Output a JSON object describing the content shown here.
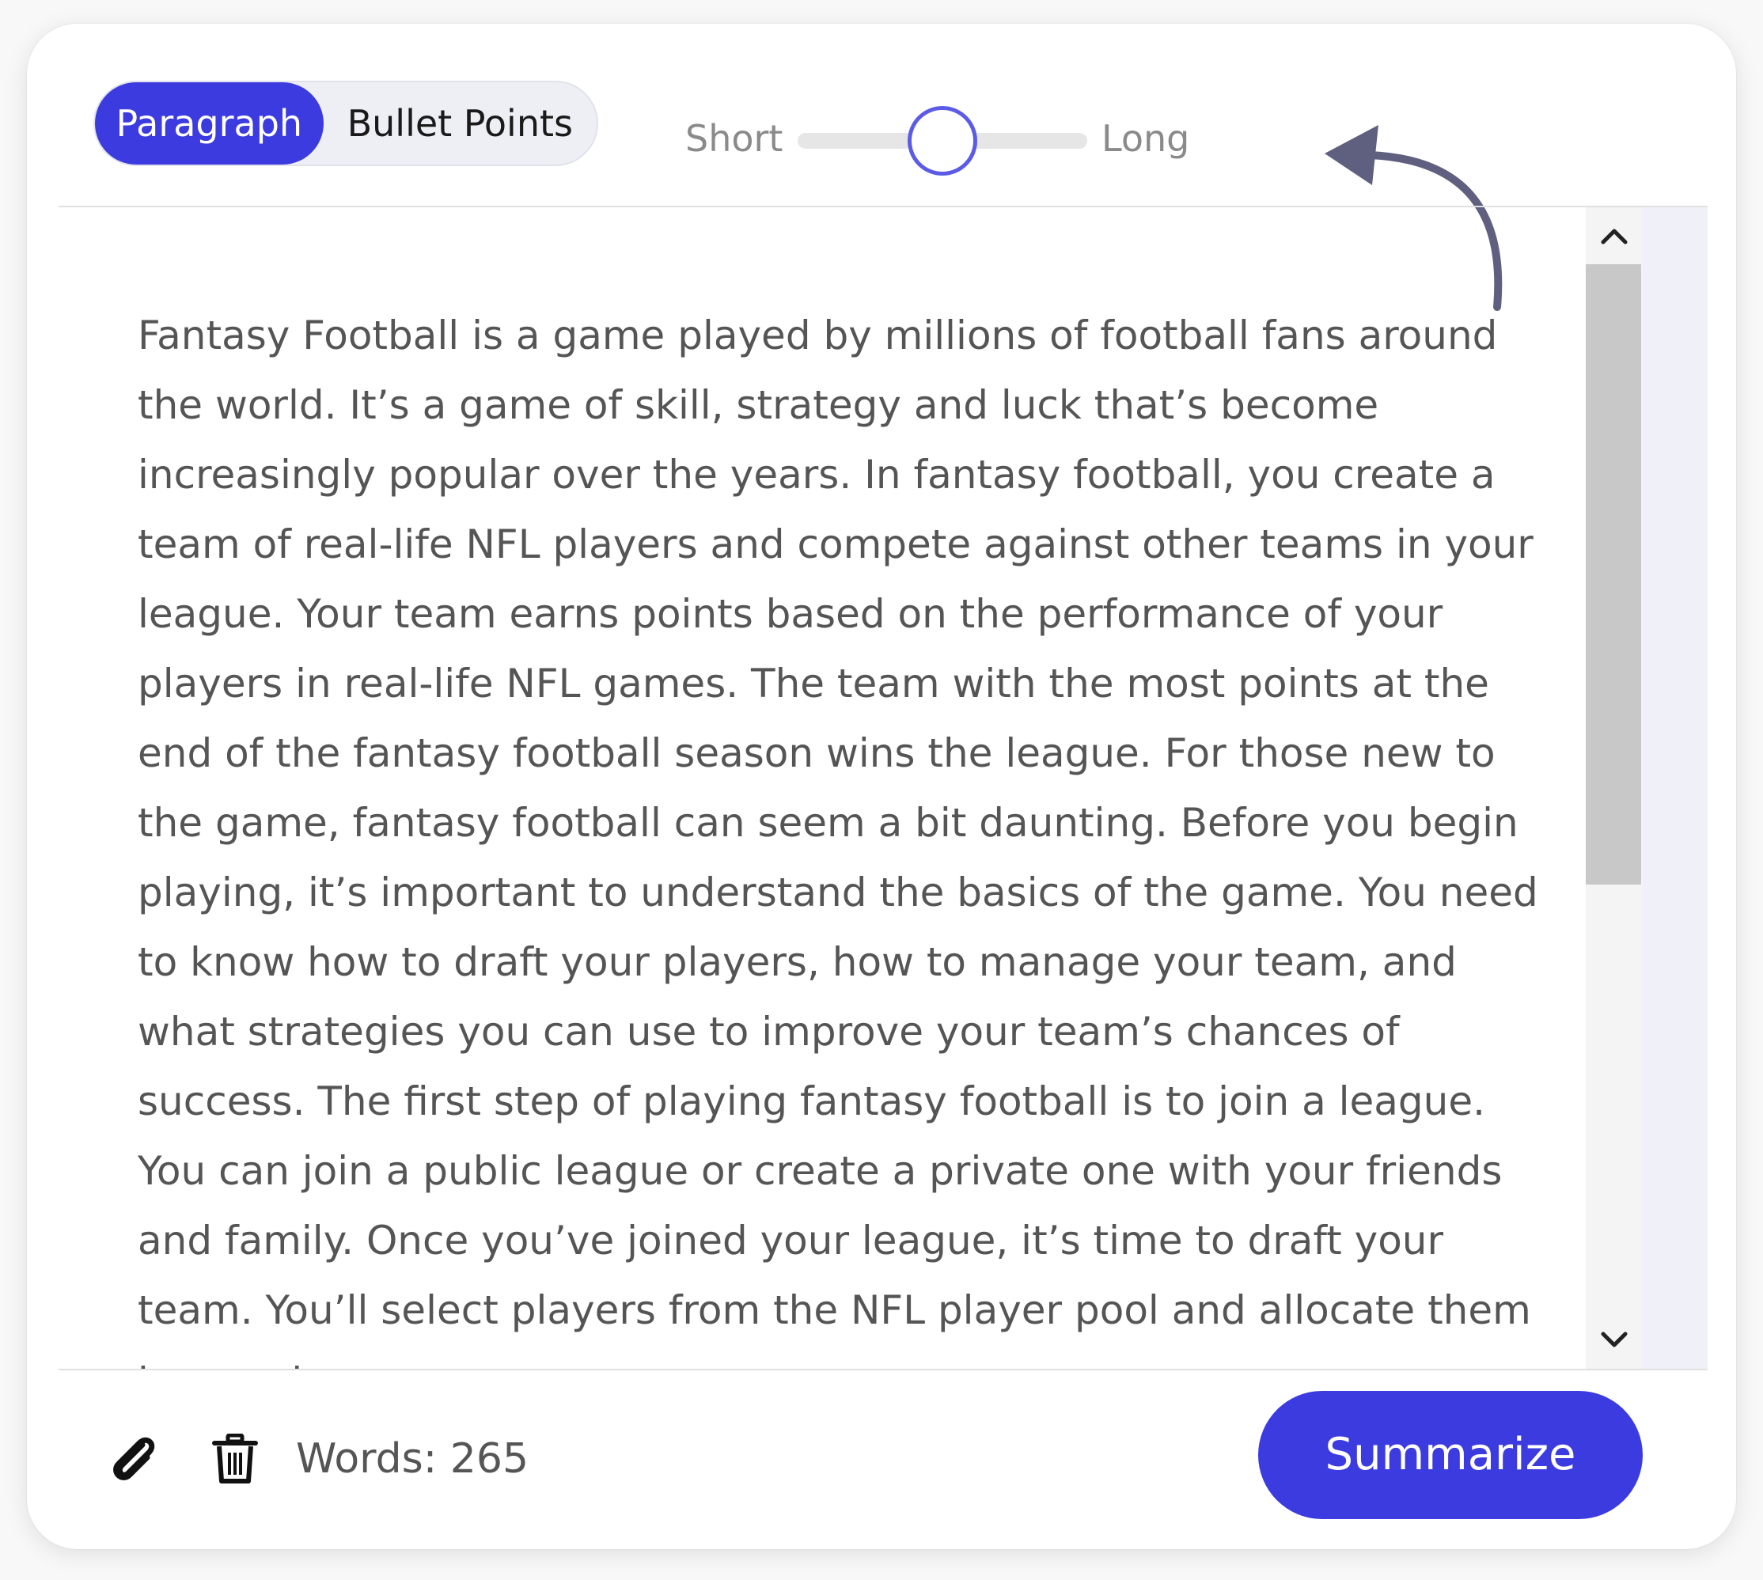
{
  "mode_toggle": {
    "options": [
      "Paragraph",
      "Bullet Points"
    ],
    "selected": "Paragraph"
  },
  "length_slider": {
    "min_label": "Short",
    "max_label": "Long",
    "value_fraction": 0.5
  },
  "content": {
    "text": "Fantasy Football is a game played by millions of football fans around the world. It’s a game of skill, strategy and luck that’s become increasingly popular over the years. In fantasy football, you create a team of real-life NFL players and compete against other teams in your league. Your team earns points based on the performance of your players in real-life NFL games. The team with the most points at the end of the fantasy football season wins the league. For those new to the game, fantasy football can seem a bit daunting. Before you begin playing, it’s important to understand the basics of the game. You need to know how to draft your players, how to manage your team, and what strategies you can use to improve your team’s chances of success. The first step of playing fantasy football is to join a league. You can join a public league or create a private one with your friends and family. Once you’ve joined your league, it’s time to draft your team. You’ll select players from the NFL player pool and allocate them to your team."
  },
  "footer": {
    "word_count_label": "Words: 265",
    "summarize_label": "Summarize",
    "attach_icon": "paperclip-icon",
    "delete_icon": "trash-icon"
  },
  "colors": {
    "accent": "#3b3be0",
    "slider_thumb_border": "#5b5be6",
    "annotation_arrow": "#5f6080",
    "body_text": "#555555"
  }
}
